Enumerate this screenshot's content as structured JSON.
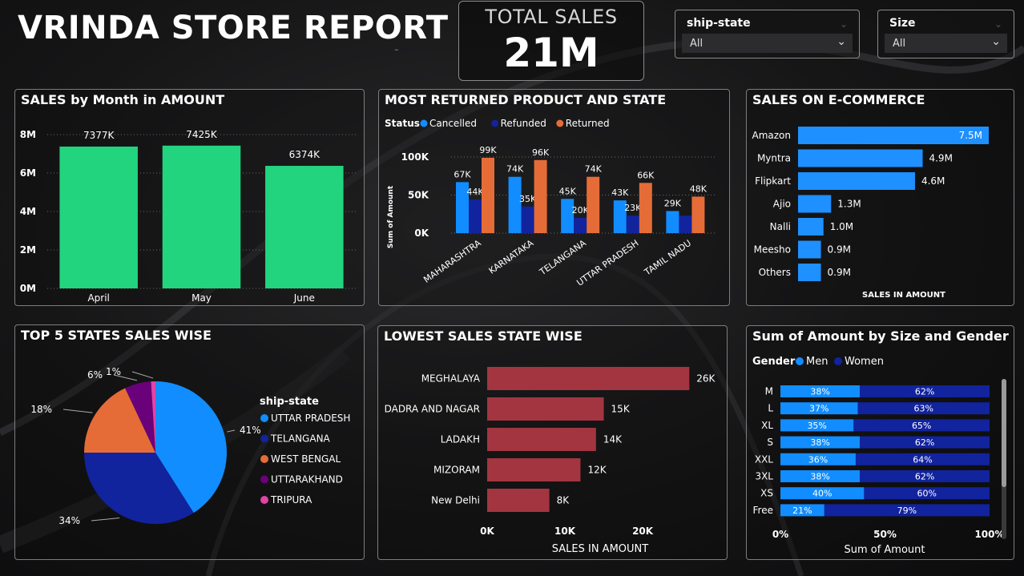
{
  "header": {
    "title": "VRINDA STORE REPORT",
    "dash": "-"
  },
  "kpi": {
    "label": "TOTAL SALES",
    "value": "21M"
  },
  "slicers": [
    {
      "label": "ship-state",
      "value": "All"
    },
    {
      "label": "Size",
      "value": "All"
    }
  ],
  "colors": {
    "green": "#22d47e",
    "blue": "#118dff",
    "navy": "#12239e",
    "orange": "#e66c37",
    "purple": "#6b007b",
    "pink": "#e044a7",
    "maroon": "#a33540",
    "light_blue": "#1e90ff"
  },
  "chart_data": [
    {
      "id": "monthly",
      "type": "bar",
      "title": "SALES by Month in AMOUNT",
      "categories": [
        "April",
        "May",
        "June"
      ],
      "values": [
        7377,
        7425,
        6374
      ],
      "data_labels": [
        "7377K",
        "7425K",
        "6374K"
      ],
      "y_ticks": [
        "8M",
        "6M",
        "4M",
        "2M",
        "0M"
      ],
      "ylim": [
        0,
        8000
      ],
      "grid": true
    },
    {
      "id": "returned",
      "type": "bar",
      "title": "MOST RETURNED PRODUCT AND STATE",
      "legend_title": "Status",
      "ylabel": "Sum of Amount",
      "categories": [
        "MAHARASHTRA",
        "KARNATAKA",
        "TELANGANA",
        "UTTAR PRADESH",
        "TAMIL NADU"
      ],
      "series": [
        {
          "name": "Cancelled",
          "color": "#118dff",
          "values": [
            67,
            74,
            45,
            43,
            29
          ],
          "labels": [
            "67K",
            "74K",
            "45K",
            "43K",
            "29K"
          ]
        },
        {
          "name": "Refunded",
          "color": "#12239e",
          "values": [
            44,
            35,
            20,
            23,
            23
          ],
          "labels": [
            "44K",
            "35K",
            "20K",
            "23K",
            ""
          ]
        },
        {
          "name": "Returned",
          "color": "#e66c37",
          "values": [
            99,
            96,
            74,
            66,
            48
          ],
          "labels": [
            "99K",
            "96K",
            "74K",
            "66K",
            "48K"
          ]
        }
      ],
      "y_ticks": [
        "100K",
        "50K",
        "0K"
      ],
      "ylim": [
        0,
        100
      ],
      "legend_position": "top-left"
    },
    {
      "id": "ecommerce",
      "type": "bar",
      "orientation": "horizontal",
      "title": "SALES ON E-COMMERCE",
      "xlabel": "SALES IN AMOUNT",
      "categories": [
        "Amazon",
        "Myntra",
        "Flipkart",
        "Ajio",
        "Nalli",
        "Meesho",
        "Others"
      ],
      "values": [
        7.5,
        4.9,
        4.6,
        1.3,
        1.0,
        0.9,
        0.9
      ],
      "data_labels": [
        "7.5M",
        "4.9M",
        "4.6M",
        "1.3M",
        "1.0M",
        "0.9M",
        "0.9M"
      ]
    },
    {
      "id": "top5",
      "type": "pie",
      "title": "TOP 5 STATES SALES WISE",
      "legend_title": "ship-state",
      "categories": [
        "UTTAR PRADESH",
        "TELANGANA",
        "WEST BENGAL",
        "UTTARAKHAND",
        "TRIPURA"
      ],
      "values": [
        41,
        34,
        18,
        6,
        1
      ],
      "data_labels": [
        "41%",
        "34%",
        "18%",
        "6%",
        "1%"
      ],
      "colors": [
        "#118dff",
        "#12239e",
        "#e66c37",
        "#6b007b",
        "#e044a7"
      ],
      "legend_position": "right"
    },
    {
      "id": "lowest",
      "type": "bar",
      "orientation": "horizontal",
      "title": "LOWEST SALES STATE WISE",
      "xlabel": "SALES IN AMOUNT",
      "categories": [
        "MEGHALAYA",
        "DADRA AND NAGAR",
        "LADAKH",
        "MIZORAM",
        "New Delhi"
      ],
      "values": [
        26,
        15,
        14,
        12,
        8
      ],
      "data_labels": [
        "26K",
        "15K",
        "14K",
        "12K",
        "8K"
      ],
      "x_ticks": [
        "0K",
        "10K",
        "20K"
      ],
      "xlim": [
        0,
        27
      ]
    },
    {
      "id": "size_gender",
      "type": "bar",
      "orientation": "horizontal",
      "stacked": "percent",
      "title": "Sum of Amount by Size and Gender",
      "legend_title": "Gender",
      "xlabel": "Sum of Amount",
      "categories": [
        "M",
        "L",
        "XL",
        "S",
        "XXL",
        "3XL",
        "XS",
        "Free"
      ],
      "series": [
        {
          "name": "Men",
          "color": "#118dff",
          "values": [
            38,
            37,
            35,
            38,
            36,
            38,
            40,
            21
          ],
          "labels": [
            "38%",
            "37%",
            "35%",
            "38%",
            "36%",
            "38%",
            "40%",
            "21%"
          ]
        },
        {
          "name": "Women",
          "color": "#12239e",
          "values": [
            62,
            63,
            65,
            62,
            64,
            62,
            60,
            79
          ],
          "labels": [
            "62%",
            "63%",
            "65%",
            "62%",
            "64%",
            "62%",
            "60%",
            "79%"
          ]
        }
      ],
      "x_ticks": [
        "0%",
        "50%",
        "100%"
      ],
      "legend_position": "top-left"
    }
  ]
}
